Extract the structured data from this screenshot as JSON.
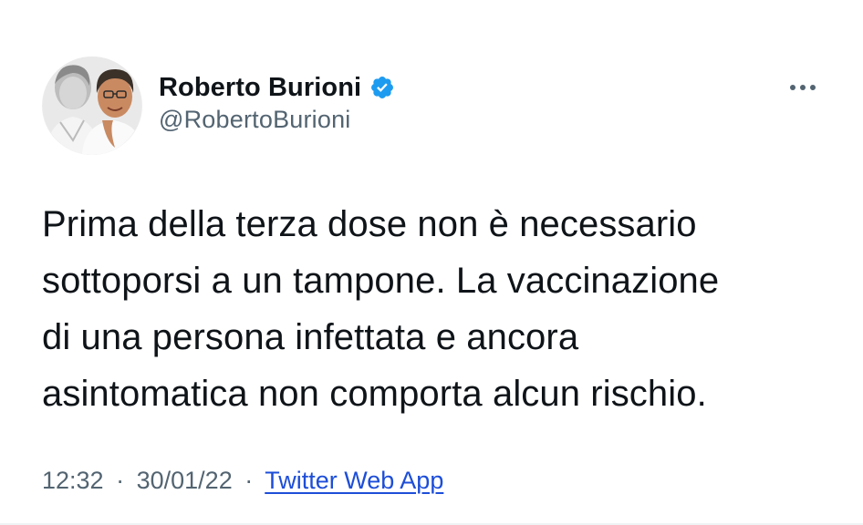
{
  "author": {
    "display_name": "Roberto Burioni",
    "handle": "@RobertoBurioni",
    "verified": true
  },
  "tweet": {
    "text": "Prima della terza dose non è necessario\nsottoporsi a un tampone. La vaccinazione\ndi una persona infettata e ancora\nasintomatica non comporta alcun rischio."
  },
  "meta": {
    "time": "12:32",
    "separator": "·",
    "date": "30/01/22",
    "source": "Twitter Web App"
  },
  "colors": {
    "text_primary": "#0f1419",
    "text_secondary": "#536471",
    "verified_badge": "#1d9bf0",
    "link": "#1d4ed8"
  },
  "icons": {
    "verified": "verified-badge-icon",
    "more": "more-options-icon"
  }
}
